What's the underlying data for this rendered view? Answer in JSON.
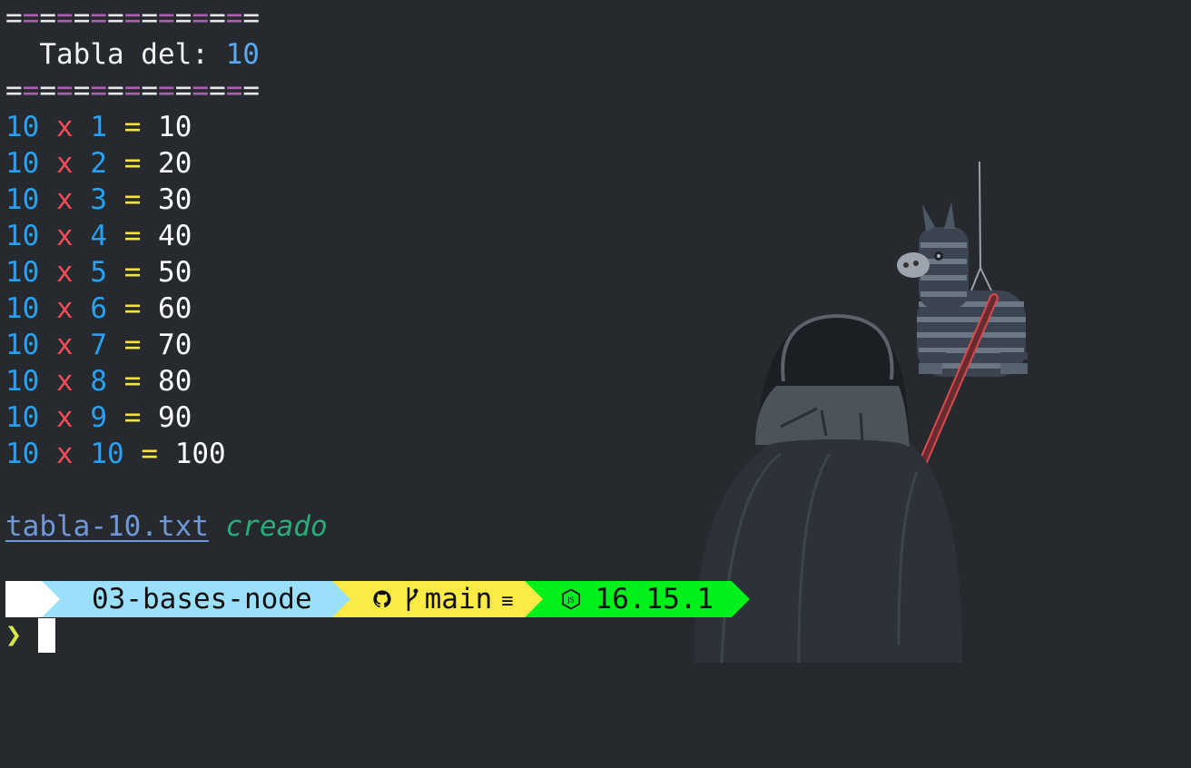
{
  "separator": "===============",
  "title": {
    "label": "  Tabla del: ",
    "number": "10"
  },
  "table_rows": [
    {
      "a": "10",
      "op": "x",
      "b": "1",
      "eq": "=",
      "result": "10"
    },
    {
      "a": "10",
      "op": "x",
      "b": "2",
      "eq": "=",
      "result": "20"
    },
    {
      "a": "10",
      "op": "x",
      "b": "3",
      "eq": "=",
      "result": "30"
    },
    {
      "a": "10",
      "op": "x",
      "b": "4",
      "eq": "=",
      "result": "40"
    },
    {
      "a": "10",
      "op": "x",
      "b": "5",
      "eq": "=",
      "result": "50"
    },
    {
      "a": "10",
      "op": "x",
      "b": "6",
      "eq": "=",
      "result": "60"
    },
    {
      "a": "10",
      "op": "x",
      "b": "7",
      "eq": "=",
      "result": "70"
    },
    {
      "a": "10",
      "op": "x",
      "b": "8",
      "eq": "=",
      "result": "80"
    },
    {
      "a": "10",
      "op": "x",
      "b": "9",
      "eq": "=",
      "result": "90"
    },
    {
      "a": "10",
      "op": "x",
      "b": "10",
      "eq": "=",
      "result": "100"
    }
  ],
  "output": {
    "filename": "tabla-10.txt",
    "status": "creado"
  },
  "prompt": {
    "os_icon": "windows-icon",
    "folder": "03-bases-node",
    "git_icon": "github-icon",
    "branch_icon": "git-branch-icon",
    "branch": "main",
    "git_status": "≡",
    "node_icon": "nodejs-icon",
    "node_version": "16.15.1",
    "symbol": "❯"
  },
  "colors": {
    "background": "#262a2f",
    "number": "#2aa1f0",
    "operator": "#ef4f5b",
    "equals": "#f7e23a",
    "result": "#ffffff",
    "separator_alt": "#b05db4",
    "path_segment": "#9be0fb",
    "git_segment": "#fdeb45",
    "node_segment": "#00f01b"
  }
}
